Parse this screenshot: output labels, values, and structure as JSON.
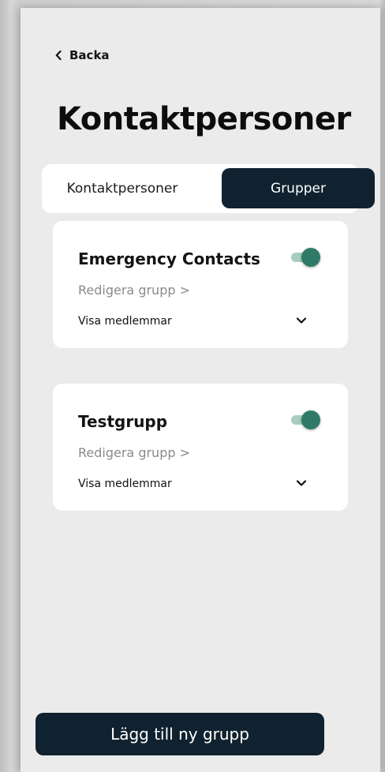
{
  "header": {
    "back_label": "Backa",
    "title": "Kontaktpersoner"
  },
  "tabs": [
    {
      "label": "Kontaktpersoner",
      "selected": false
    },
    {
      "label": "Grupper",
      "selected": true
    }
  ],
  "groups": [
    {
      "name": "Emergency Contacts",
      "enabled": true,
      "edit_label": "Redigera grupp >",
      "members_label": "Visa medlemmar"
    },
    {
      "name": "Testgrupp",
      "enabled": true,
      "edit_label": "Redigera grupp >",
      "members_label": "Visa medlemmar"
    }
  ],
  "footer": {
    "add_group_label": "Lägg till ny grupp"
  },
  "colors": {
    "primary_dark": "#10222f",
    "toggle_on": "#2f7a66",
    "toggle_track": "#a8ccc1",
    "background": "#ebebeb"
  },
  "icons": {
    "back": "chevron-left-icon",
    "expand": "chevron-down-icon"
  }
}
